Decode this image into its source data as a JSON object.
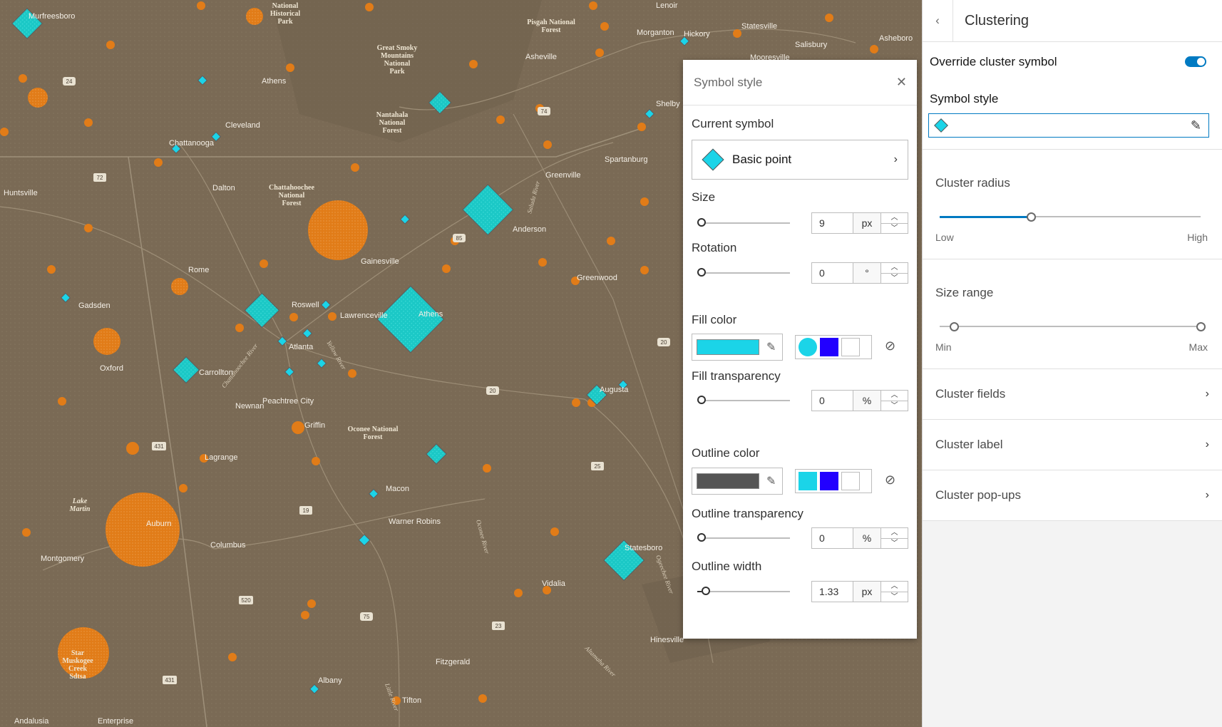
{
  "map": {
    "cities": [
      "Murfreesboro",
      "Athens",
      "Cleveland",
      "Chattanooga",
      "Dalton",
      "Huntsville",
      "Rome",
      "Gadsden",
      "Roswell",
      "Lawrenceville",
      "Atlanta",
      "Carrollton",
      "Oxford",
      "Newnan",
      "Peachtree City",
      "Griffin",
      "Lagrange",
      "Auburn",
      "Columbus",
      "Montgomery",
      "Macon",
      "Warner Robins",
      "Albany",
      "Fitzgerald",
      "Tifton",
      "Enterprise",
      "Andalusia",
      "Gainesville",
      "Athens",
      "Anderson",
      "Greenwood",
      "Greenville",
      "Spartanburg",
      "Shelby",
      "Asheville",
      "Morganton",
      "Hickory",
      "Lenoir",
      "Statesville",
      "Salisbury",
      "Asheboro",
      "Mooresville",
      "Augusta",
      "Statesboro",
      "Vidalia",
      "Hinesville"
    ],
    "parks": [
      "Pisgah National Forest",
      "Great Smoky Mountains National Park",
      "Nantahala National Forest",
      "Chattahoochee National Forest",
      "Oconee National Forest",
      "Lake Martin",
      "Star Muskogee Creek Sdtsa",
      "Historical Park",
      "National"
    ],
    "rivers": [
      "Saluda River",
      "Chattahoochee River",
      "Yellow River",
      "Oconee River",
      "Ogeechee River",
      "Altamaha River",
      "Little River"
    ],
    "highways": [
      "24",
      "72",
      "85",
      "74",
      "20",
      "20",
      "431",
      "19",
      "25",
      "520",
      "75",
      "23",
      "431"
    ]
  },
  "symbol_panel": {
    "title": "Symbol style",
    "current_symbol_label": "Current symbol",
    "current_symbol": "Basic point",
    "size_label": "Size",
    "size_value": "9",
    "size_unit": "px",
    "rotation_label": "Rotation",
    "rotation_value": "0",
    "rotation_unit": "°",
    "fill_color_label": "Fill color",
    "fill_color": "#1bd4e8",
    "fill_recent": [
      "#1bd4e8",
      "#2200ff",
      "#ffffff"
    ],
    "fill_transparency_label": "Fill transparency",
    "fill_transparency_value": "0",
    "fill_transparency_unit": "%",
    "outline_color_label": "Outline color",
    "outline_color": "#555555",
    "outline_recent": [
      "#1bd4e8",
      "#2200ff",
      "#ffffff"
    ],
    "outline_transparency_label": "Outline transparency",
    "outline_transparency_value": "0",
    "outline_transparency_unit": "%",
    "outline_width_label": "Outline width",
    "outline_width_value": "1.33",
    "outline_width_unit": "px"
  },
  "side_panel": {
    "title": "Clustering",
    "override_label": "Override cluster symbol",
    "override_on": true,
    "symbol_style_label": "Symbol style",
    "cluster_radius_label": "Cluster radius",
    "cluster_radius_value": 0.35,
    "radius_min": "Low",
    "radius_max": "High",
    "size_range_label": "Size range",
    "size_range_min_value": 0.0,
    "size_range_max_value": 1.0,
    "size_min": "Min",
    "size_max": "Max",
    "nav": [
      "Cluster fields",
      "Cluster label",
      "Cluster pop-ups"
    ],
    "accent_color": "#007ac2"
  }
}
